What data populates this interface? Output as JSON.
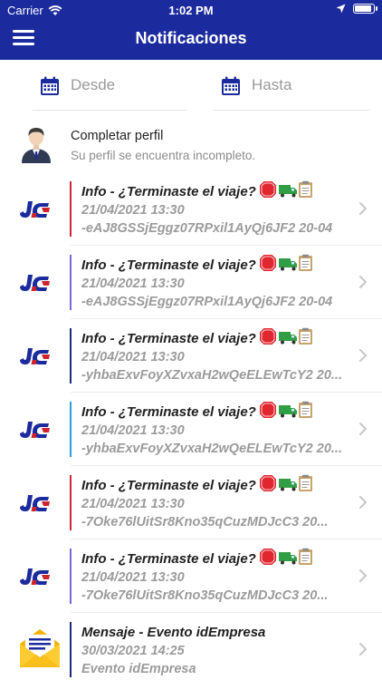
{
  "status": {
    "carrier": "Carrier",
    "time": "1:02 PM"
  },
  "nav": {
    "title": "Notificaciones"
  },
  "filters": {
    "desde_placeholder": "Desde",
    "hasta_placeholder": "Hasta"
  },
  "profile": {
    "title": "Completar perfil",
    "subtitle": "Su perfil se encuentra incompleto."
  },
  "colors": {
    "nav_bg": "#1b2b9e",
    "bar_red": "#cc2936",
    "bar_purple": "#7b68d8",
    "bar_navy": "#1b2b7a",
    "bar_cyan": "#2aa0d8"
  },
  "notifications": [
    {
      "title": "Info - ¿Terminaste el viaje?",
      "date": "21/04/2021 13:30",
      "detail": "-eAJ8GSSjEggz07RPxil1AyQj6JF2 20-04",
      "bar_color": "#cc2936",
      "icon": "company-logo-icon",
      "emojis": true
    },
    {
      "title": "Info - ¿Terminaste el viaje?",
      "date": "21/04/2021 13:30",
      "detail": "-eAJ8GSSjEggz07RPxil1AyQj6JF2 20-04",
      "bar_color": "#7b68d8",
      "icon": "company-logo-icon",
      "emojis": true
    },
    {
      "title": "Info - ¿Terminaste el viaje?",
      "date": "21/04/2021 13:30",
      "detail": "-yhbaExvFoyXZvxaH2wQeELEwTcY2 20...",
      "bar_color": "#1b2b7a",
      "icon": "company-logo-icon",
      "emojis": true
    },
    {
      "title": "Info - ¿Terminaste el viaje?",
      "date": "21/04/2021 13:30",
      "detail": "-yhbaExvFoyXZvxaH2wQeELEwTcY2 20...",
      "bar_color": "#2aa0d8",
      "icon": "company-logo-icon",
      "emojis": true
    },
    {
      "title": "Info - ¿Terminaste el viaje?",
      "date": "21/04/2021 13:30",
      "detail": "-7Oke76lUitSr8Kno35qCuzMDJcC3 20...",
      "bar_color": "#cc2936",
      "icon": "company-logo-icon",
      "emojis": true
    },
    {
      "title": "Info - ¿Terminaste el viaje?",
      "date": "21/04/2021 13:30",
      "detail": "-7Oke76lUitSr8Kno35qCuzMDJcC3 20...",
      "bar_color": "#7b68d8",
      "icon": "company-logo-icon",
      "emojis": true
    },
    {
      "title": "Mensaje - Evento idEmpresa",
      "date": "30/03/2021 14:25",
      "detail": "Evento idEmpresa",
      "bar_color": "#1b2b7a",
      "icon": "envelope-icon",
      "emojis": false
    }
  ]
}
